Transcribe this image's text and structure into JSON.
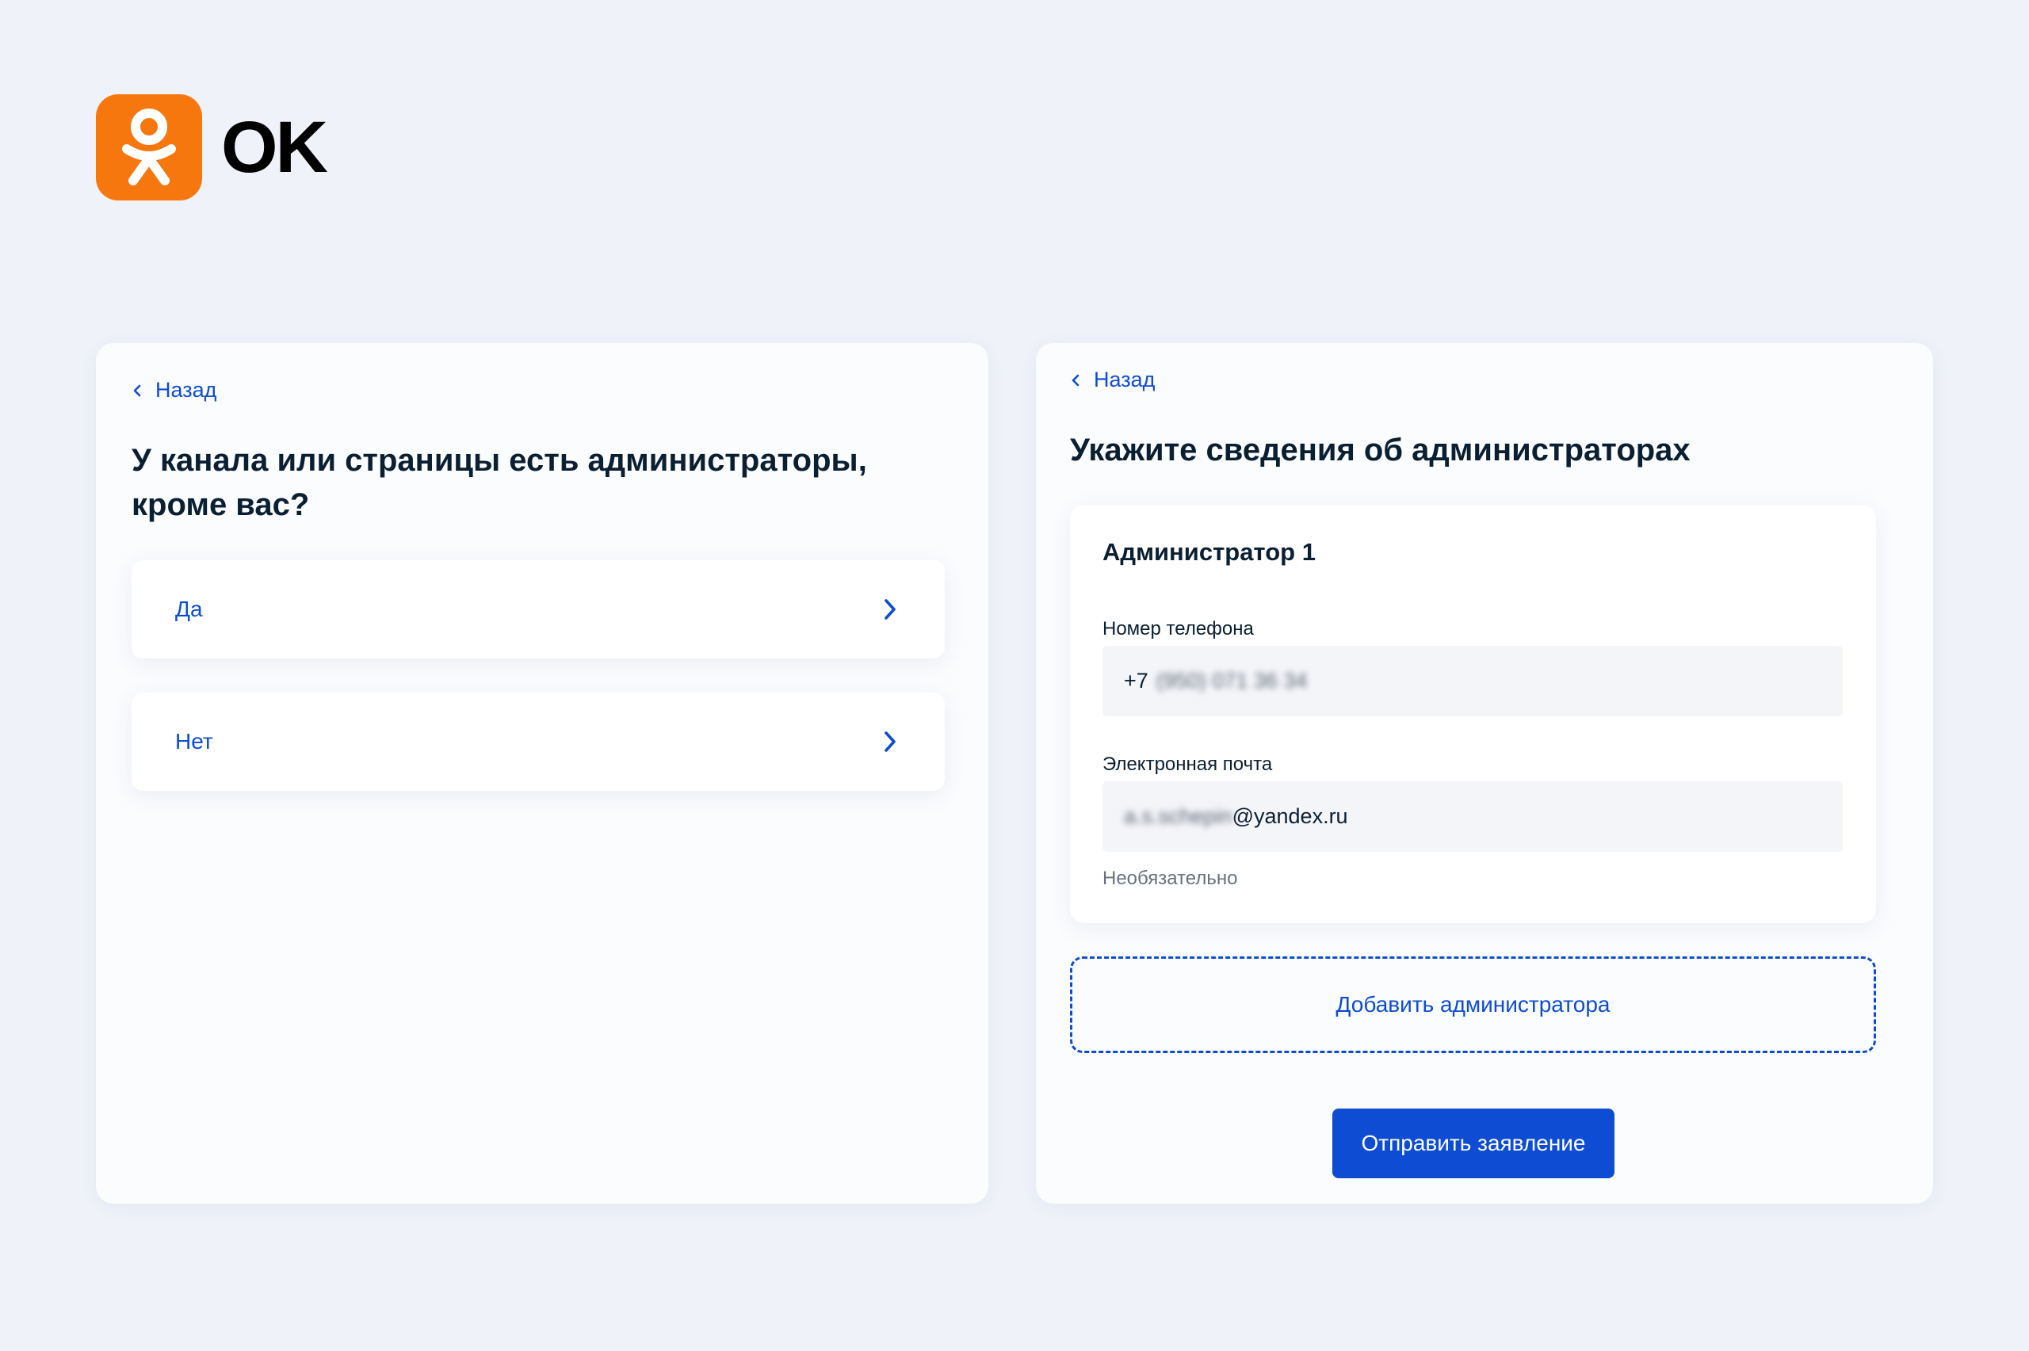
{
  "brand": {
    "name": "OK",
    "color": "#f7770f"
  },
  "left_panel": {
    "back_label": "Назад",
    "question": "У канала или страницы есть администраторы, кроме вас?",
    "options": [
      {
        "label": "Да"
      },
      {
        "label": "Нет"
      }
    ]
  },
  "right_panel": {
    "back_label": "Назад",
    "title": "Укажите сведения об администраторах",
    "admin": {
      "title": "Администратор 1",
      "phone_label": "Номер телефона",
      "phone_prefix": "+7",
      "phone_masked": "(950) 071 36 34",
      "email_label": "Электронная почта",
      "email_masked": "a.s.schepin",
      "email_domain": "@yandex.ru",
      "email_hint": "Необязательно"
    },
    "add_admin_label": "Добавить администратора",
    "submit_label": "Отправить заявление"
  },
  "colors": {
    "accent": "#0d4cd3",
    "background": "#eff2f9",
    "text": "#0b1f33"
  }
}
